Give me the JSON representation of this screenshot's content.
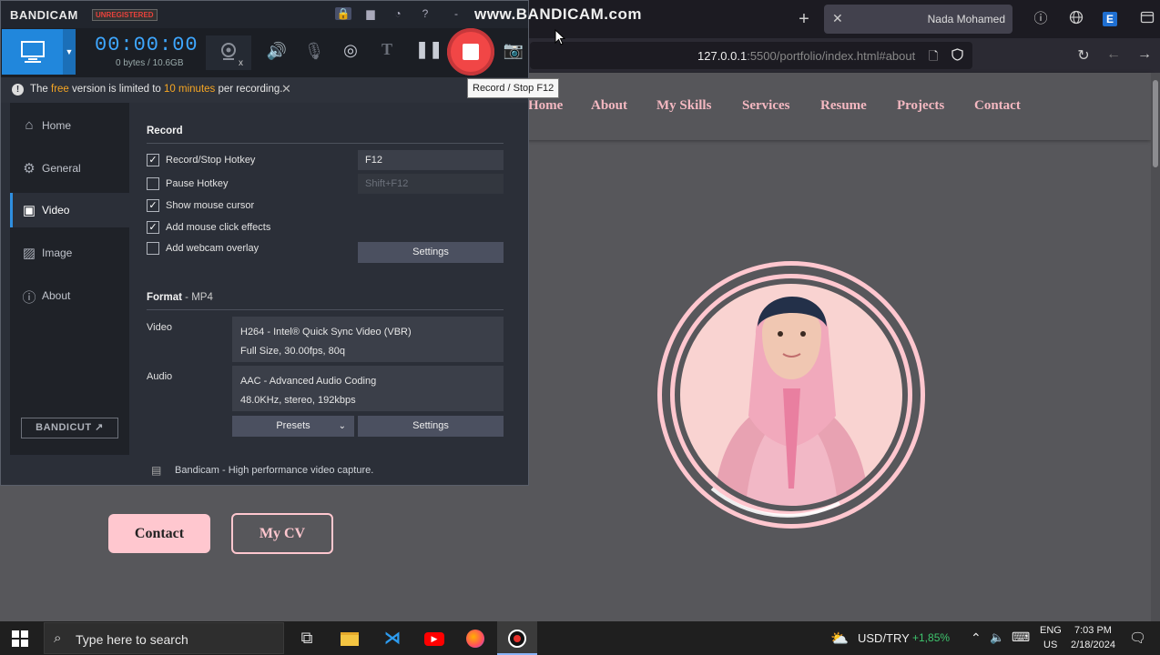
{
  "browser": {
    "tab_title": "Nada Mohamed",
    "url_host": "127.0.0.1",
    "url_path": ":5500/portfolio/index.html#about",
    "extension_letter": "E"
  },
  "site": {
    "nav": [
      "Home",
      "About",
      "My Skills",
      "Services",
      "Resume",
      "Projects",
      "Contact"
    ],
    "contact_button": "Contact",
    "cv_button": "My CV",
    "accent_color": "#ffc7cf"
  },
  "bandicam": {
    "logo": "BANDICAM",
    "badge": "UNREGISTERED",
    "watermark": "www.BANDICAM.com",
    "timer": "00:00:00",
    "bytes": "0 bytes / 10.6GB",
    "tooltip": "Record / Stop   F12",
    "notice": {
      "before": "The ",
      "free": "free",
      "middle": " version is limited to ",
      "limit": "10 minutes",
      "after": " per recording."
    },
    "sidebar": [
      {
        "label": "Home",
        "icon": "home-icon"
      },
      {
        "label": "General",
        "icon": "gear-icon"
      },
      {
        "label": "Video",
        "icon": "video-settings-icon"
      },
      {
        "label": "Image",
        "icon": "image-icon"
      },
      {
        "label": "About",
        "icon": "info-icon"
      }
    ],
    "bandicut_label": "BANDICUT",
    "record": {
      "title": "Record",
      "options": [
        {
          "label": "Record/Stop Hotkey",
          "checked": true
        },
        {
          "label": "Pause Hotkey",
          "checked": false
        },
        {
          "label": "Show mouse cursor",
          "checked": true
        },
        {
          "label": "Add mouse click effects",
          "checked": true
        },
        {
          "label": "Add webcam overlay",
          "checked": false
        }
      ],
      "record_hotkey": "F12",
      "pause_hotkey": "Shift+F12",
      "settings_label": "Settings"
    },
    "format": {
      "title": "Format",
      "container": " - MP4",
      "video_label": "Video",
      "video_line1": "H264 - Intel® Quick Sync Video (VBR)",
      "video_line2": "Full Size, 30.00fps, 80q",
      "audio_label": "Audio",
      "audio_line1": "AAC - Advanced Audio Coding",
      "audio_line2": "48.0KHz, stereo, 192kbps",
      "presets_label": "Presets",
      "settings_label": "Settings"
    },
    "footer": "Bandicam - High performance video capture."
  },
  "taskbar": {
    "search_placeholder": "Type here to search",
    "ticker": "USD/TRY",
    "ticker_change": "+1,85%",
    "lang1": "ENG",
    "lang2": "US",
    "time": "7:03 PM",
    "date": "2/18/2024"
  }
}
